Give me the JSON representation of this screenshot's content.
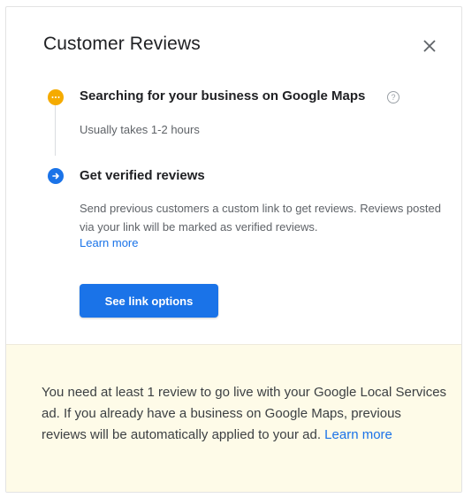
{
  "dialog": {
    "title": "Customer Reviews"
  },
  "steps": [
    {
      "title": "Searching for your business on Google Maps",
      "status_icon": "pending-dots-icon",
      "subtitle": "Usually takes 1-2 hours",
      "help_icon": "help-circle-icon"
    },
    {
      "title": "Get verified reviews",
      "status_icon": "arrow-right-circle-icon",
      "description": "Send previous customers a custom link to get reviews. Reviews posted via your link will be marked as verified reviews.",
      "link": "Learn more",
      "button": "See link options"
    }
  ],
  "notice": {
    "text": "You need at least 1 review to go live with your Google Local Services ad. If you already have a business on Google Maps, previous reviews will be automatically applied to your ad.",
    "link": "Learn more"
  },
  "colors": {
    "accent": "#1a73e8",
    "pending": "#f5ab00",
    "notice_bg": "#fefbe8"
  }
}
